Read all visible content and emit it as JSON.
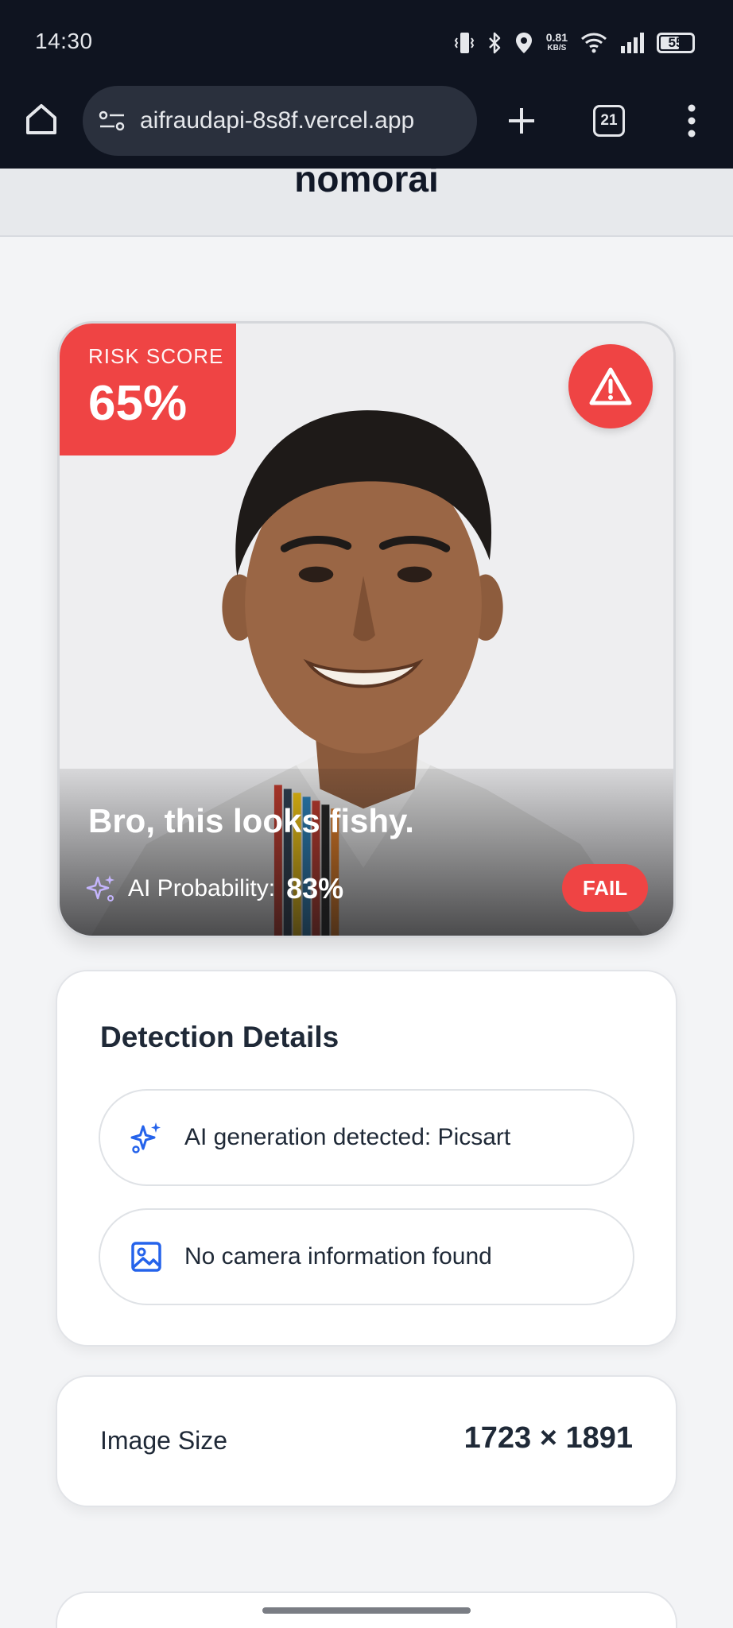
{
  "status_bar": {
    "time": "14:30",
    "net_speed_value": "0.81",
    "net_speed_unit": "KB/S",
    "battery": "55",
    "icons": [
      "vibrate-icon",
      "bluetooth-icon",
      "location-icon",
      "wifi-icon",
      "signal-icon",
      "battery-icon"
    ]
  },
  "browser": {
    "url": "aifraudapi-8s8f.vercel.app",
    "tab_count": "21",
    "icons": [
      "home-icon",
      "site-settings-icon",
      "plus-icon",
      "tabs-icon",
      "more-vert-icon"
    ]
  },
  "header": {
    "brand": "nomorai"
  },
  "result": {
    "risk_label": "RISK SCORE",
    "risk_value": "65%",
    "verdict": "Bro, this looks fishy.",
    "ai_probability_label": "AI Probability:",
    "ai_probability_value": "83%",
    "status": "FAIL",
    "accent_color": "#ef4444"
  },
  "details": {
    "title": "Detection Details",
    "items": [
      {
        "icon": "sparkles-icon",
        "text": "AI generation detected: Picsart"
      },
      {
        "icon": "image-icon",
        "text": "No camera information found"
      }
    ]
  },
  "image_size": {
    "label": "Image Size",
    "value": "1723 × 1891"
  }
}
